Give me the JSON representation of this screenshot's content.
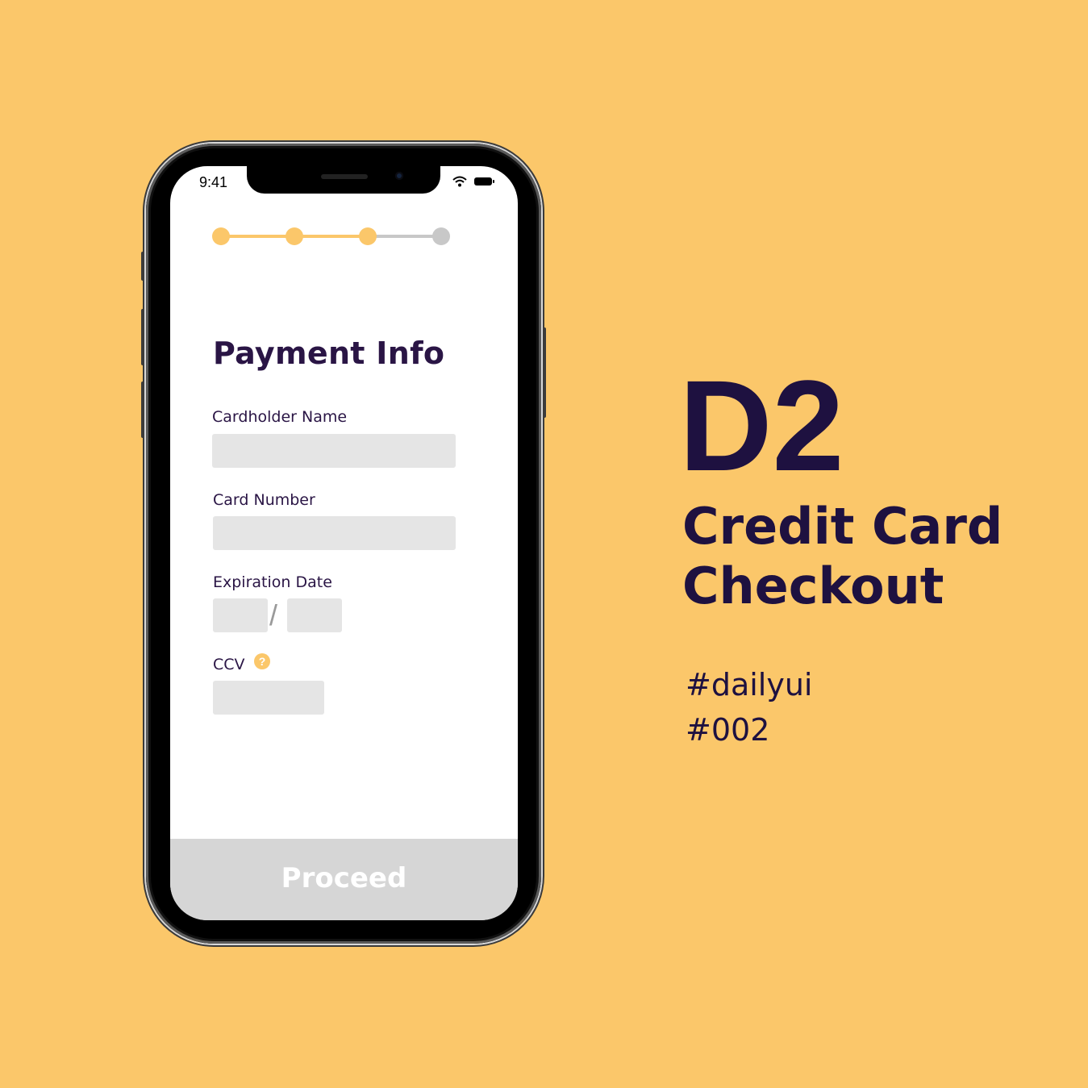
{
  "colors": {
    "background": "#FBC76A",
    "accent": "#FBC76A",
    "text_dark": "#1E1140",
    "inactive": "#C8C8C8",
    "field_bg": "#E5E5E5",
    "button_disabled": "#D6D6D6"
  },
  "status_bar": {
    "time": "9:41",
    "icons": [
      "wifi-icon",
      "battery-icon"
    ]
  },
  "stepper": {
    "total_steps": 4,
    "completed_steps": 3
  },
  "form": {
    "title": "Payment Info",
    "cardholder_label": "Cardholder Name",
    "card_number_label": "Card Number",
    "expiration_label": "Expiration Date",
    "expiration_separator": "/",
    "ccv_label": "CCV",
    "ccv_help": "?",
    "cardholder_value": "",
    "card_number_value": "",
    "exp_month_value": "",
    "exp_year_value": "",
    "ccv_value": ""
  },
  "proceed_button": {
    "label": "Proceed",
    "enabled": false
  },
  "caption": {
    "code": "D2",
    "title_line1": "Credit Card",
    "title_line2": "Checkout",
    "tag1": "#dailyui",
    "tag2": "#002"
  }
}
